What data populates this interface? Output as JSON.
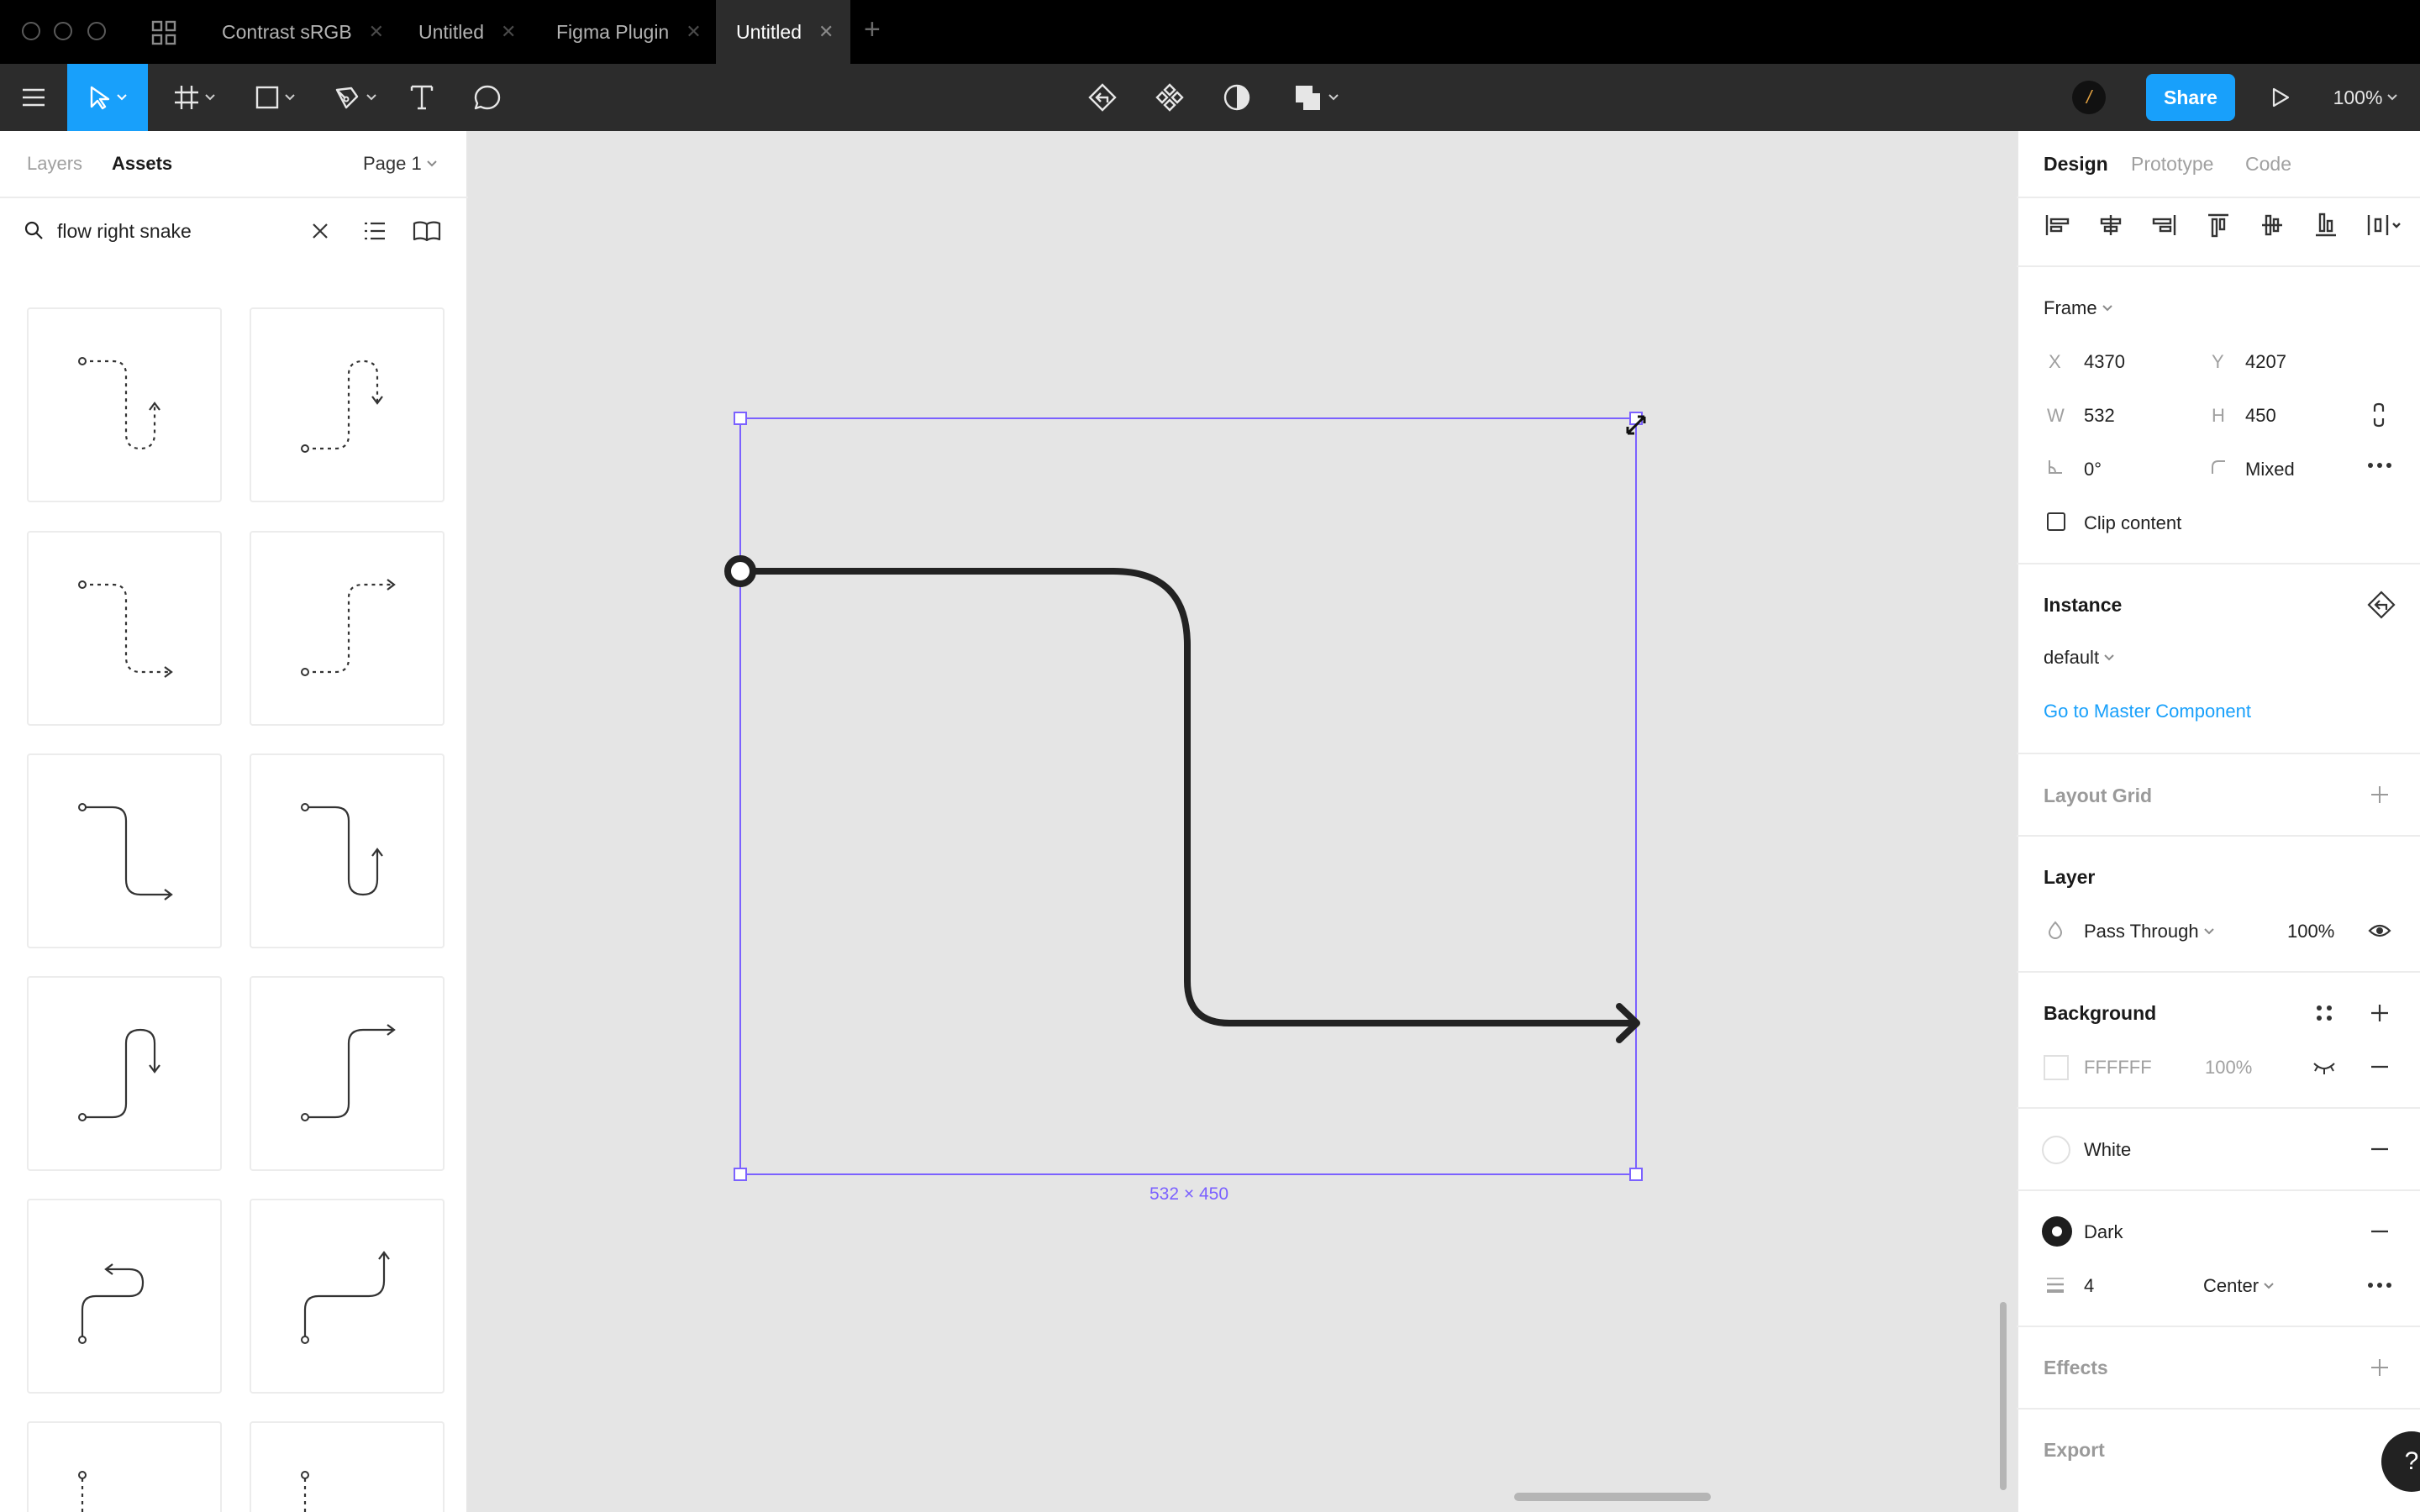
{
  "tabs": [
    {
      "label": "Contrast sRGB",
      "close": "✕"
    },
    {
      "label": "Untitled",
      "close": "✕"
    },
    {
      "label": "Figma Plugin",
      "close": "✕"
    },
    {
      "label": "Untitled",
      "close": "✕"
    }
  ],
  "new_tab": "+",
  "toolbar": {
    "share_label": "Share",
    "zoom": "100%",
    "avatar_initial": "/"
  },
  "left_panel": {
    "tabs": [
      "Layers",
      "Assets"
    ],
    "active_tab": "Assets",
    "page_label": "Page 1",
    "search_value": "flow right snake"
  },
  "canvas": {
    "size_label": "532 × 450"
  },
  "right_panel": {
    "tabs": [
      "Design",
      "Prototype",
      "Code"
    ],
    "active_tab": "Design",
    "frame": {
      "type_label": "Frame",
      "x_label": "X",
      "x": "4370",
      "y_label": "Y",
      "y": "4207",
      "w_label": "W",
      "w": "532",
      "h_label": "H",
      "h": "450",
      "rotation": "0°",
      "radius": "Mixed",
      "clip_label": "Clip content"
    },
    "instance": {
      "title": "Instance",
      "variant": "default",
      "master_link": "Go to Master Component"
    },
    "layout_grid": "Layout Grid",
    "layer": {
      "title": "Layer",
      "blend": "Pass Through",
      "opacity": "100%"
    },
    "background": {
      "title": "Background",
      "hex": "FFFFFF",
      "opacity": "100%"
    },
    "styles": [
      {
        "name": "White",
        "swatch": "#ffffff"
      },
      {
        "name": "Dark",
        "swatch": "#1e1e1e"
      }
    ],
    "stroke": {
      "weight": "4",
      "align": "Center"
    },
    "effects": "Effects",
    "export": "Export",
    "help": "?"
  },
  "colors": {
    "accent": "#18a0fb",
    "selection": "#7b61ff",
    "link": "#18a0fb",
    "arrow": "#222222"
  }
}
